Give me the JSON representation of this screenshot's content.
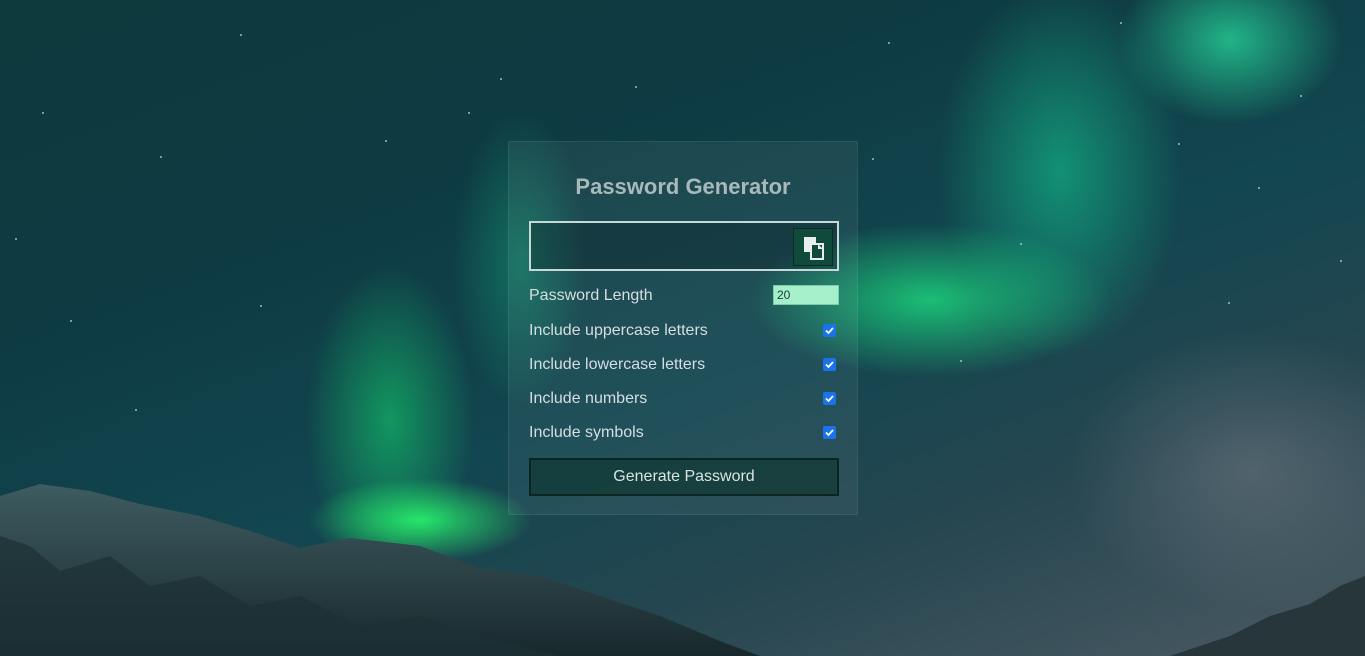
{
  "app": {
    "title": "Password Generator"
  },
  "output": {
    "value": "",
    "copy_icon": "clipboard-copy-icon"
  },
  "settings": {
    "length_label": "Password Length",
    "length_value": "20",
    "options": [
      {
        "label": "Include uppercase letters",
        "checked": true
      },
      {
        "label": "Include lowercase letters",
        "checked": true
      },
      {
        "label": "Include numbers",
        "checked": true
      },
      {
        "label": "Include symbols",
        "checked": true
      }
    ]
  },
  "actions": {
    "generate_label": "Generate Password"
  },
  "colors": {
    "accent": "#1a73e8",
    "length_input_bg": "#a5f0cb",
    "title": "#a9b9bb"
  }
}
